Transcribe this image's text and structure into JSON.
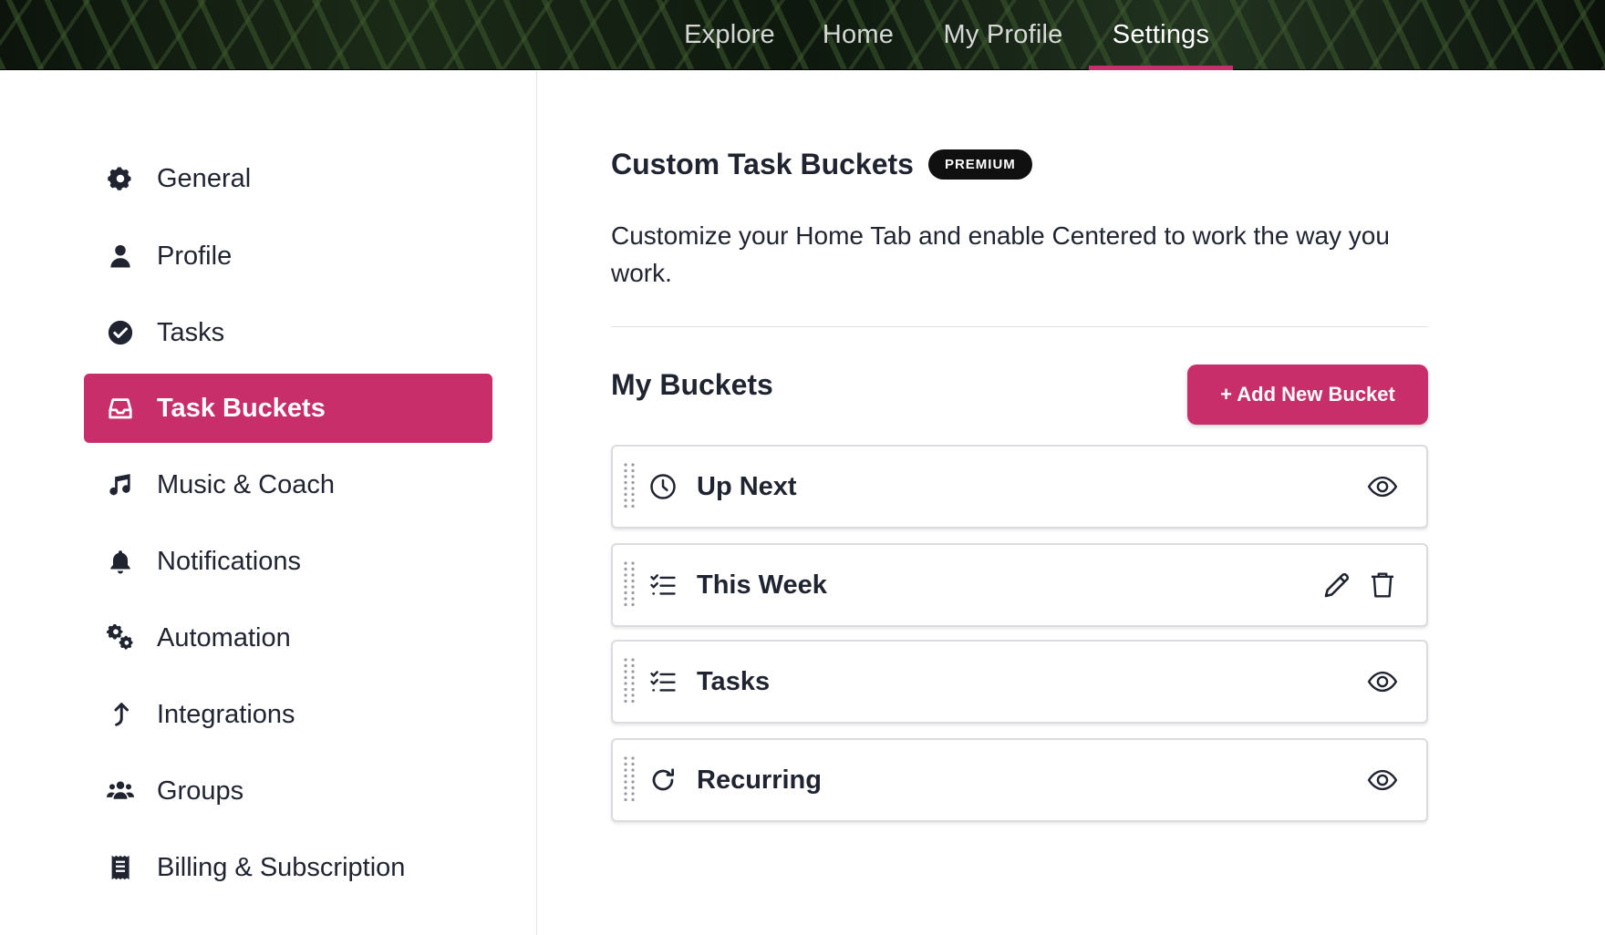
{
  "topnav": {
    "tabs": [
      {
        "label": "Explore"
      },
      {
        "label": "Home"
      },
      {
        "label": "My Profile"
      },
      {
        "label": "Settings"
      }
    ],
    "active": "Settings"
  },
  "sidebar": {
    "items": [
      {
        "label": "General",
        "icon": "gear-icon"
      },
      {
        "label": "Profile",
        "icon": "user-icon"
      },
      {
        "label": "Tasks",
        "icon": "check-circle-icon"
      },
      {
        "label": "Task Buckets",
        "icon": "inbox-icon"
      },
      {
        "label": "Music & Coach",
        "icon": "music-icon"
      },
      {
        "label": "Notifications",
        "icon": "bell-icon"
      },
      {
        "label": "Automation",
        "icon": "gears-icon"
      },
      {
        "label": "Integrations",
        "icon": "arrow-up-icon"
      },
      {
        "label": "Groups",
        "icon": "users-icon"
      },
      {
        "label": "Billing & Subscription",
        "icon": "receipt-icon"
      }
    ],
    "active": "Task Buckets"
  },
  "main": {
    "title": "Custom Task Buckets",
    "badge": "PREMIUM",
    "description": "Customize your Home Tab and enable Centered to work the way you work.",
    "section_title": "My Buckets",
    "add_button": "+ Add New Bucket",
    "buckets": [
      {
        "name": "Up Next",
        "icon": "clock-icon",
        "actions": [
          "eye-icon"
        ]
      },
      {
        "name": "This Week",
        "icon": "list-check-icon",
        "actions": [
          "pencil-icon",
          "trash-icon"
        ]
      },
      {
        "name": "Tasks",
        "icon": "list-check-icon",
        "actions": [
          "eye-icon"
        ]
      },
      {
        "name": "Recurring",
        "icon": "refresh-icon",
        "actions": [
          "eye-icon"
        ]
      }
    ]
  },
  "colors": {
    "accent": "#c72e6a",
    "text": "#1f2430",
    "badge_bg": "#101010",
    "border": "#dcdce0"
  }
}
